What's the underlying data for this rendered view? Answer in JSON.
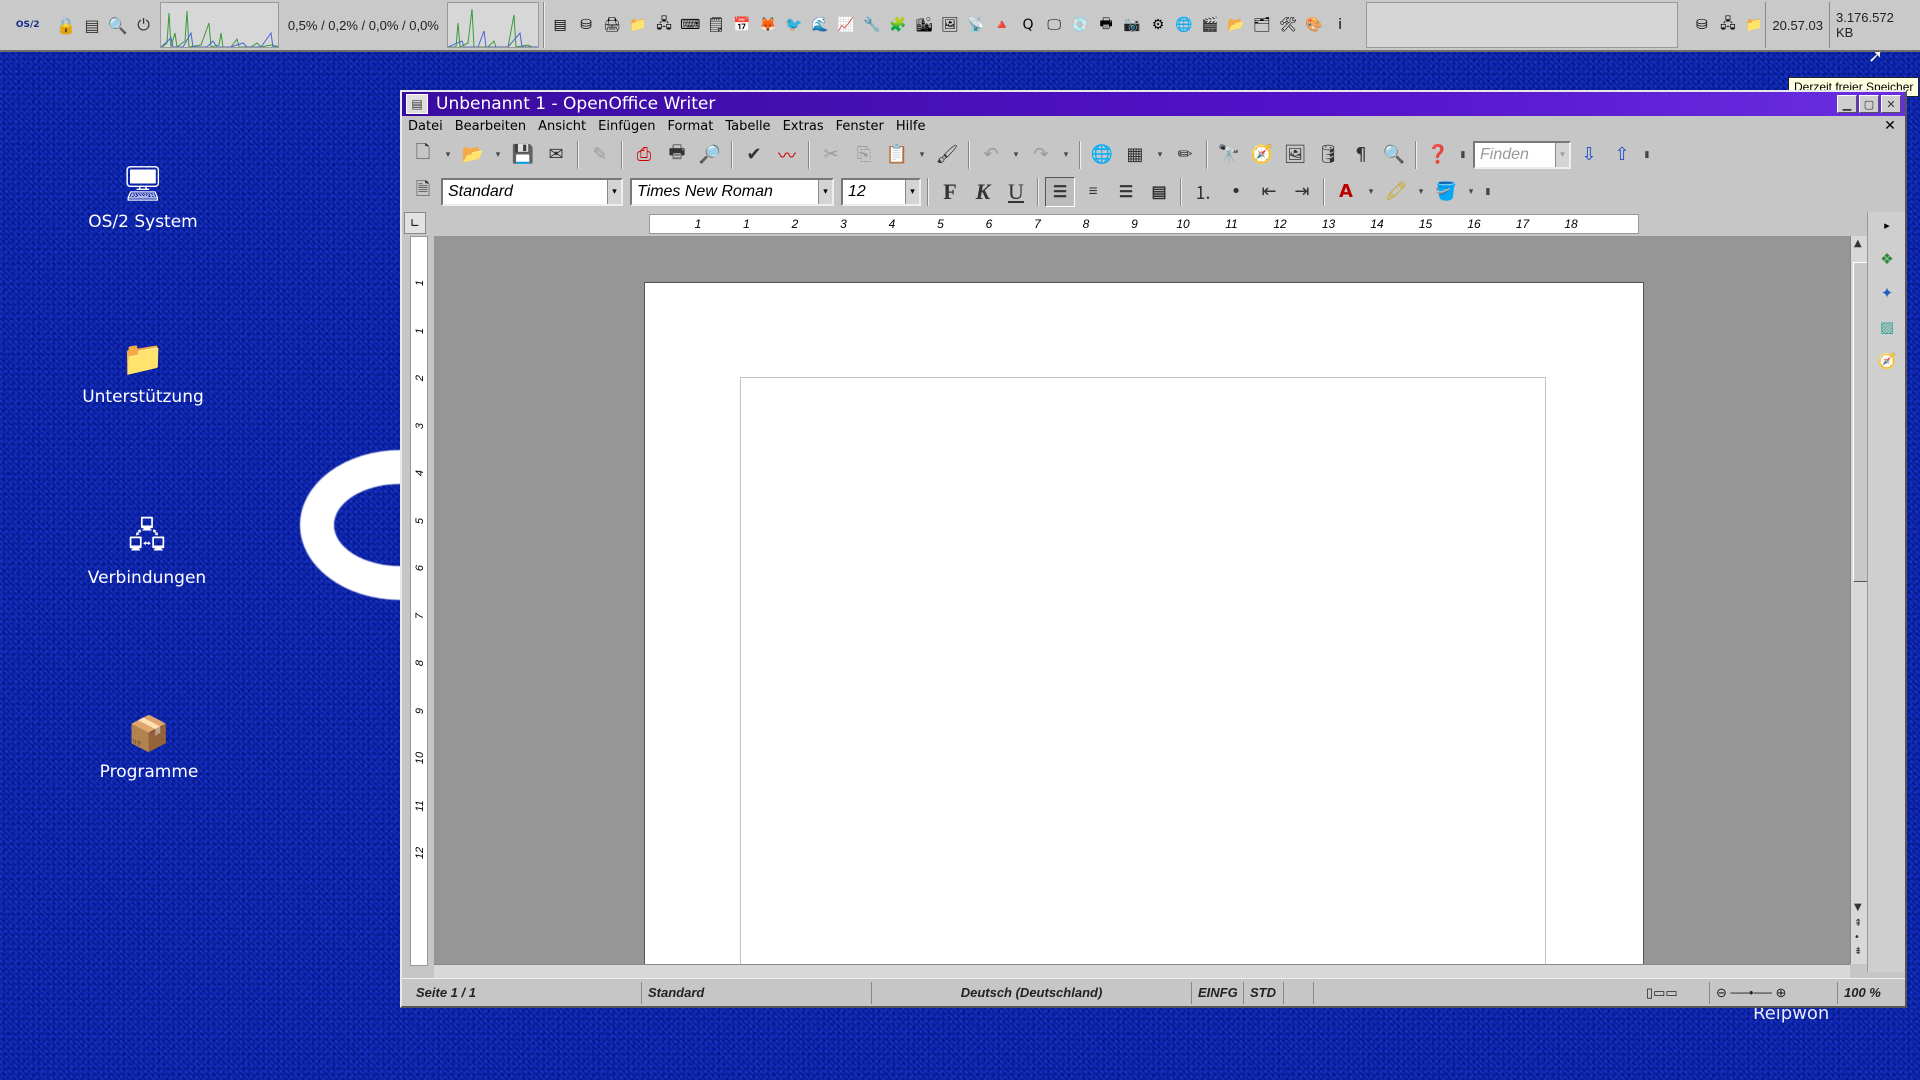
{
  "taskbar": {
    "logo_text": "OS/2",
    "cpu_load": "0,5% / 0,2% / 0,0% / 0,0%",
    "clock": "20.57.03",
    "free_memory": "3.176.572 KB",
    "tray_icons": [
      "list-icon",
      "drive-icon",
      "printer-icon",
      "folder-icon",
      "network-icon",
      "keyboard-icon",
      "notes-icon",
      "calendar-icon",
      "firefox-icon",
      "thunderbird-icon",
      "seamonkey-icon",
      "chart-icon",
      "tools-icon",
      "puzzle-icon",
      "city-icon",
      "image-icon",
      "antenna-icon",
      "vlc-icon",
      "qt-icon",
      "monitor-icon",
      "cd-icon",
      "print-icon",
      "photo-icon",
      "gear-icon",
      "globe-icon",
      "media-icon",
      "folder2-icon",
      "folder3-icon",
      "settings-icon",
      "paint-icon",
      "intel-icon"
    ],
    "right_icons": [
      "drive-icon",
      "network-icon",
      "folder-icon"
    ]
  },
  "tooltip": "Derzeit freier Speicher",
  "desktop": {
    "icons": [
      {
        "label": "OS/2 System",
        "icon": "computer-icon"
      },
      {
        "label": "Unterstützung",
        "icon": "help-folder-icon"
      },
      {
        "label": "Verbindungen",
        "icon": "network-icon"
      },
      {
        "label": "Programme",
        "icon": "programs-icon"
      }
    ],
    "bottom_text": "Reipwon"
  },
  "window": {
    "title": "Unbenannt 1 - OpenOffice Writer",
    "menu": [
      "Datei",
      "Bearbeiten",
      "Ansicht",
      "Einfügen",
      "Format",
      "Tabelle",
      "Extras",
      "Fenster",
      "Hilfe"
    ],
    "find_placeholder": "Finden",
    "paragraph_style": "Standard",
    "font_name": "Times New Roman",
    "font_size": "12",
    "bold_label": "F",
    "italic_label": "K",
    "underline_label": "U",
    "ruler_marks": [
      "1",
      "1",
      "2",
      "3",
      "4",
      "5",
      "6",
      "7",
      "8",
      "9",
      "10",
      "11",
      "12",
      "13",
      "14",
      "15",
      "16",
      "17",
      "18"
    ],
    "vruler_marks": [
      "1",
      "1",
      "2",
      "3",
      "4",
      "5",
      "6",
      "7",
      "8",
      "9",
      "10",
      "11",
      "12"
    ],
    "status": {
      "page": "Seite 1 / 1",
      "style": "Standard",
      "language": "Deutsch (Deutschland)",
      "insert_mode": "EINFG",
      "selection_mode": "STD",
      "zoom": "100 %"
    }
  },
  "colors": {
    "desktop": "#0a22a8",
    "titlebar": "#4a12c0",
    "window_bg": "#c6c6c6",
    "canvas": "#969696"
  }
}
